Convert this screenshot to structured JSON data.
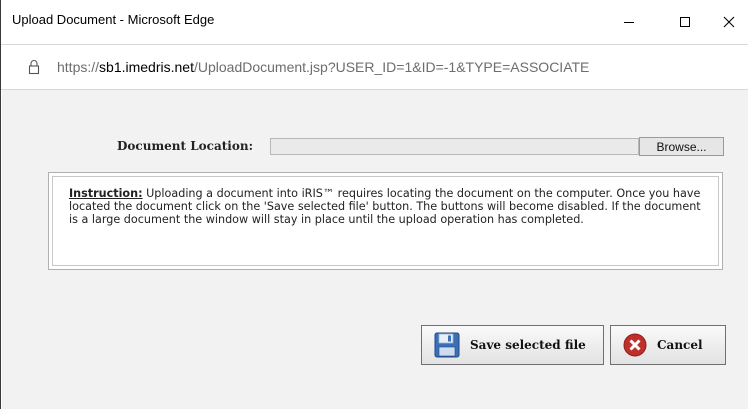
{
  "window": {
    "title": "Upload Document - Microsoft Edge",
    "controls": {
      "minimize": "—",
      "maximize": "☐",
      "close": "✕"
    }
  },
  "address_bar": {
    "scheme": "https://",
    "host": "sb1.imedris.net",
    "path": "/UploadDocument.jsp?USER_ID=1&ID=-1&TYPE=ASSOCIATE",
    "icon": "lock-icon"
  },
  "form": {
    "document_location_label": "Document Location:",
    "file_input_value": "",
    "browse_label": "Browse..."
  },
  "instruction": {
    "lead": "Instruction:",
    "text": " Uploading a document into iRIS™ requires locating the document on the computer. Once you have located the document click on the 'Save selected file' button. The buttons will become disabled. If the document is a large document the window will stay in place until the upload operation has completed."
  },
  "buttons": {
    "save_label": "Save selected file",
    "save_icon": "floppy-disk-icon",
    "cancel_label": "Cancel",
    "cancel_icon": "red-x-circle-icon"
  },
  "colors": {
    "content_bg": "#f2f2f2",
    "cancel_red": "#c0302a",
    "floppy_blue": "#3b6fb6"
  }
}
